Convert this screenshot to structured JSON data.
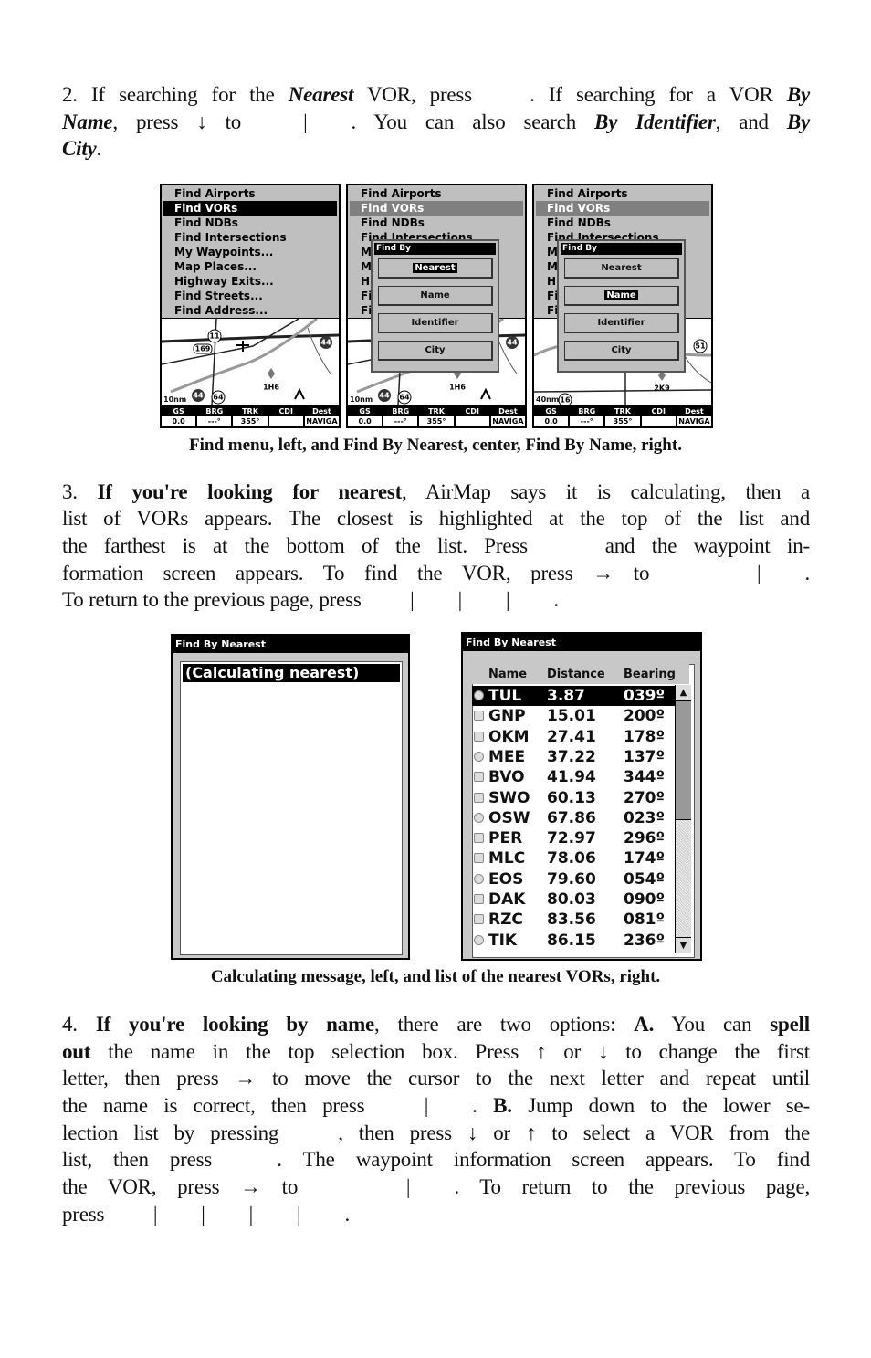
{
  "para2": [
    [
      [
        "2. If searching for the ",
        ""
      ],
      [
        "Nearest",
        "bi"
      ],
      [
        " VOR, press ",
        ""
      ],
      [
        "",
        "gap"
      ],
      [
        ". If searching for a VOR ",
        ""
      ],
      [
        "By",
        "bi"
      ]
    ],
    [
      [
        "Name",
        "bi"
      ],
      [
        ", press ↓ to ",
        ""
      ],
      [
        "",
        "gap"
      ],
      [
        "|",
        ""
      ],
      [
        "",
        "gap"
      ],
      [
        ". You can also search ",
        ""
      ],
      [
        "By Identifier",
        "bi"
      ],
      [
        ", and ",
        ""
      ],
      [
        "By",
        "bi"
      ]
    ],
    [
      [
        "City",
        "bi"
      ],
      [
        ".",
        ""
      ]
    ]
  ],
  "caption1": "Find menu, left, and Find By Nearest, center, Find By Name, right.",
  "para3": [
    [
      [
        "3. ",
        ""
      ],
      [
        "If you're looking for nearest",
        "b"
      ],
      [
        ", AirMap says it is calculating, then a",
        ""
      ]
    ],
    [
      [
        "list of VORs appears. The closest is highlighted at the top of the list and",
        ""
      ]
    ],
    [
      [
        "the farthest is at the bottom of the list. Press ",
        ""
      ],
      [
        "",
        "gap"
      ],
      [
        " and the waypoint in-",
        ""
      ]
    ],
    [
      [
        "formation screen appears. To find the VOR, press → to ",
        ""
      ],
      [
        "",
        "gap"
      ],
      [
        "",
        "gap"
      ],
      [
        "|",
        ""
      ],
      [
        "",
        "gap"
      ],
      [
        ".",
        ""
      ]
    ],
    [
      [
        "To return to the previous page, press ",
        ""
      ],
      [
        "",
        "gap"
      ],
      [
        "|",
        ""
      ],
      [
        "",
        "gap"
      ],
      [
        "|",
        ""
      ],
      [
        "",
        "gap"
      ],
      [
        "|",
        ""
      ],
      [
        "",
        "gap"
      ],
      [
        ".",
        ""
      ]
    ]
  ],
  "caption2": "Calculating message, left, and list of the nearest VORs, right.",
  "para4": [
    [
      [
        "4. ",
        ""
      ],
      [
        "If you're looking by name",
        "b"
      ],
      [
        ", there are two options: ",
        ""
      ],
      [
        "A.",
        "b"
      ],
      [
        " You can ",
        ""
      ],
      [
        "spell",
        "b"
      ]
    ],
    [
      [
        "out",
        "b"
      ],
      [
        " the name in the top selection box. Press ↑ or ↓ to change the first",
        ""
      ]
    ],
    [
      [
        "letter, then press → to move the cursor to the next letter and repeat until",
        ""
      ]
    ],
    [
      [
        "the name is correct, then press ",
        ""
      ],
      [
        "",
        "gap"
      ],
      [
        "|",
        ""
      ],
      [
        "",
        "gap"
      ],
      [
        ". ",
        ""
      ],
      [
        "B.",
        "b"
      ],
      [
        " Jump down to the lower se-",
        ""
      ]
    ],
    [
      [
        "lection list by pressing ",
        ""
      ],
      [
        "",
        "gap"
      ],
      [
        ", then press ↓ or ↑ to select a VOR from the",
        ""
      ]
    ],
    [
      [
        "list, then press ",
        ""
      ],
      [
        "",
        "gap"
      ],
      [
        ". The waypoint information screen appears. To find",
        ""
      ]
    ],
    [
      [
        "the VOR, press → to ",
        ""
      ],
      [
        "",
        "gap"
      ],
      [
        "",
        "gap"
      ],
      [
        "|",
        ""
      ],
      [
        "",
        "gap"
      ],
      [
        ". To return to the previous page,",
        ""
      ]
    ],
    [
      [
        "press ",
        ""
      ],
      [
        "",
        "gap"
      ],
      [
        "|",
        ""
      ],
      [
        "",
        "gap"
      ],
      [
        "|",
        ""
      ],
      [
        "",
        "gap"
      ],
      [
        "|",
        ""
      ],
      [
        "",
        "gap"
      ],
      [
        "|",
        ""
      ],
      [
        "",
        "gap"
      ],
      [
        ".",
        ""
      ]
    ]
  ],
  "find_menu": {
    "items": [
      "Find Airports",
      "Find VORs",
      "Find NDBs",
      "Find Intersections",
      "My Waypoints...",
      "Map Places...",
      "Highway Exits...",
      "Find Streets...",
      "Find Address..."
    ],
    "selected": "Find VORs"
  },
  "find_by": {
    "title": "Find By",
    "options": [
      "Nearest",
      "Name",
      "Identifier",
      "City"
    ]
  },
  "map_labels": {
    "left": [
      "11",
      "169",
      "44",
      "1H6",
      "44",
      "64",
      "10nm"
    ],
    "right": [
      "51",
      "2K9",
      "40nm",
      "16"
    ]
  },
  "status_bar": {
    "headers": [
      "GS",
      "BRG",
      "TRK",
      "CDI",
      "Dest"
    ],
    "values": [
      "0.0",
      "---°",
      "355°",
      "",
      "NAVIGA"
    ]
  },
  "calc_screen": {
    "title": "Find By Nearest",
    "message": "(Calculating nearest)"
  },
  "nearest_list": {
    "title": "Find By Nearest",
    "columns": [
      "Name",
      "Distance",
      "Bearing"
    ],
    "rows": [
      [
        "TUL",
        "3.87",
        "039º"
      ],
      [
        "GNP",
        "15.01",
        "200º"
      ],
      [
        "OKM",
        "27.41",
        "178º"
      ],
      [
        "MEE",
        "37.22",
        "137º"
      ],
      [
        "BVO",
        "41.94",
        "344º"
      ],
      [
        "SWO",
        "60.13",
        "270º"
      ],
      [
        "OSW",
        "67.86",
        "023º"
      ],
      [
        "PER",
        "72.97",
        "296º"
      ],
      [
        "MLC",
        "78.06",
        "174º"
      ],
      [
        "EOS",
        "79.60",
        "054º"
      ],
      [
        "DAK",
        "80.03",
        "090º"
      ],
      [
        "RZC",
        "83.56",
        "081º"
      ],
      [
        "TIK",
        "86.15",
        "236º"
      ]
    ],
    "selected_index": 0,
    "scroll_fraction": 0.5
  }
}
